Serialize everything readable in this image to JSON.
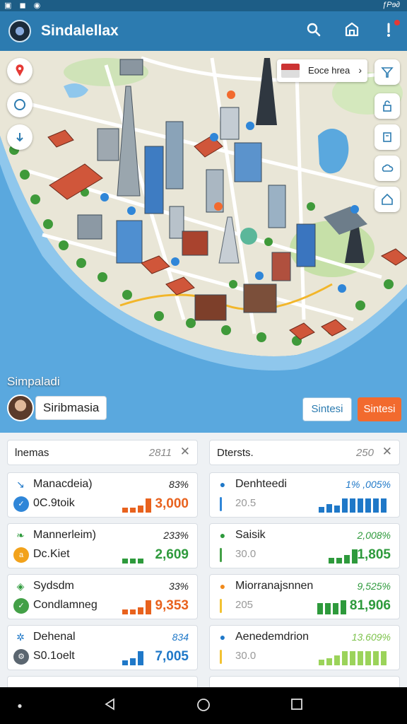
{
  "status": {
    "right": "ƒPɘ∂"
  },
  "app": {
    "title": "Sindalellax"
  },
  "header": {
    "icons": [
      "search-icon",
      "layers-icon",
      "alert-icon"
    ]
  },
  "map": {
    "place_card": {
      "text": "Eoce hrea"
    },
    "label": "Simpaladi",
    "user_name": "Siribmasia",
    "btn_outline": "Sintesi",
    "btn_fill": "Sintesi",
    "colors": {
      "water": "#5aa8de",
      "land": "#e9e6d7",
      "park": "#b7d99c",
      "road": "#ffffff",
      "accent": "#f26a2e",
      "primary": "#2c7bb0"
    }
  },
  "left_column": {
    "title": "lnemas",
    "count": "2811",
    "cards": [
      {
        "icon": "chart-icon",
        "name": "Manacdeia)",
        "pct": "83%",
        "circle_color": "#2f86d8",
        "sub": "0C.9toik",
        "value": "3,000",
        "value_color": "#e8621e",
        "bar_color": "#e8621e"
      },
      {
        "icon": "leaf-icon",
        "name": "Mannerleim)",
        "pct": "233%",
        "circle_color": "#f2a21b",
        "sub": "Dc.Kiet",
        "value": "2,609",
        "value_color": "#2e9a3c",
        "bar_color": "#2e9a3c"
      },
      {
        "icon": "shield-icon",
        "name": "Sydsdm",
        "pct": "33%",
        "circle_color": "#43a047",
        "sub": "Condlamneg",
        "value": "9,353",
        "value_color": "#e8621e",
        "bar_color": "#e8621e"
      },
      {
        "icon": "settings-icon",
        "name": "Dehenal",
        "pct": "834",
        "circle_color": "#5b6670",
        "sub": "S0.1oelt",
        "value": "7,005",
        "value_color": "#1f78c8",
        "bar_color": "#1f78c8"
      }
    ]
  },
  "right_column": {
    "title": "Dtersts.",
    "count": "250",
    "cards": [
      {
        "icon": "pin-icon",
        "name": "Denhteedi",
        "pct": "1% ,005%",
        "line_color": "#2f86d8",
        "sub": "20.5",
        "value": "",
        "value_color": "#1f78c8",
        "bar_color": "#1f78c8"
      },
      {
        "icon": "pin-icon",
        "name": "Saisik",
        "pct": "2,008%",
        "line_color": "#43a047",
        "sub": "30.0",
        "value": "1,805",
        "value_color": "#2e9a3c",
        "bar_color": "#2e9a3c"
      },
      {
        "icon": "pin-icon",
        "name": "Miorranajsnnen",
        "pct": "9,525%",
        "line_color": "#f2c232",
        "sub": "205",
        "value": "81,906",
        "value_color": "#2e9a3c",
        "bar_color": "#2e9a3c"
      },
      {
        "icon": "pin-icon",
        "name": "Aenedemdrion",
        "pct": "13.609%",
        "line_color": "#f2c232",
        "sub": "30.0",
        "value": "",
        "value_color": "#7cc24a",
        "bar_color": "#9bd35a"
      }
    ]
  }
}
